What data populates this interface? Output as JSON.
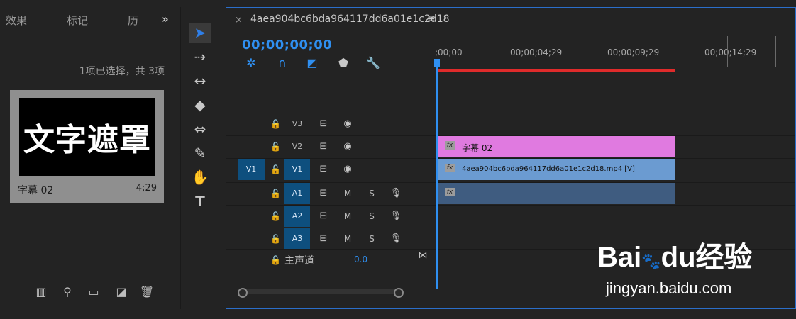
{
  "project_panel": {
    "tabs": [
      "效果",
      "标记",
      "历"
    ],
    "overflow": "»",
    "selection_info": "1项已选择，共 3项",
    "item": {
      "thumb_text": "文字遮罩",
      "name": "字幕 02",
      "duration": "4;29"
    },
    "bottom_icons": [
      "list-view-icon",
      "search-icon",
      "folder-icon",
      "new-item-icon",
      "trash-icon"
    ]
  },
  "tools": [
    "selection-tool",
    "track-select-tool",
    "ripple-edit-tool",
    "razor-tool",
    "slip-tool",
    "pen-tool",
    "hand-tool",
    "type-tool"
  ],
  "timeline": {
    "close": "×",
    "title": "4aea904bc6bda964117dd6a01e1c2d18",
    "menu": "≡",
    "timecode": "00;00;00;00",
    "ruler_labels": [
      ";00;00",
      "00;00;04;29",
      "00;00;09;29",
      "00;00;14;29"
    ],
    "video_tracks": [
      {
        "name": "V3",
        "source": "",
        "targeted": false
      },
      {
        "name": "V2",
        "source": "",
        "targeted": false
      },
      {
        "name": "V1",
        "source": "V1",
        "targeted": true
      }
    ],
    "audio_tracks": [
      {
        "name": "A1",
        "m": "M",
        "s": "S"
      },
      {
        "name": "A2",
        "m": "M",
        "s": "S"
      },
      {
        "name": "A3",
        "m": "M",
        "s": "S"
      }
    ],
    "master": {
      "label": "主声道",
      "value": "0.0"
    },
    "clips": {
      "v2": {
        "fx": "fx",
        "label": "字幕 02",
        "color": "#e07ae0"
      },
      "v1": {
        "fx": "fx",
        "label": "4aea904bc6bda964117dd6a01e1c2d18.mp4 [V]",
        "color": "#6b9bd1"
      },
      "a1": {
        "fx": "fx",
        "color": "#3f5c80"
      }
    }
  },
  "watermark": {
    "brand": "Bai",
    "brand2": "du",
    "suffix": "经验",
    "url": "jingyan.baidu.com"
  }
}
